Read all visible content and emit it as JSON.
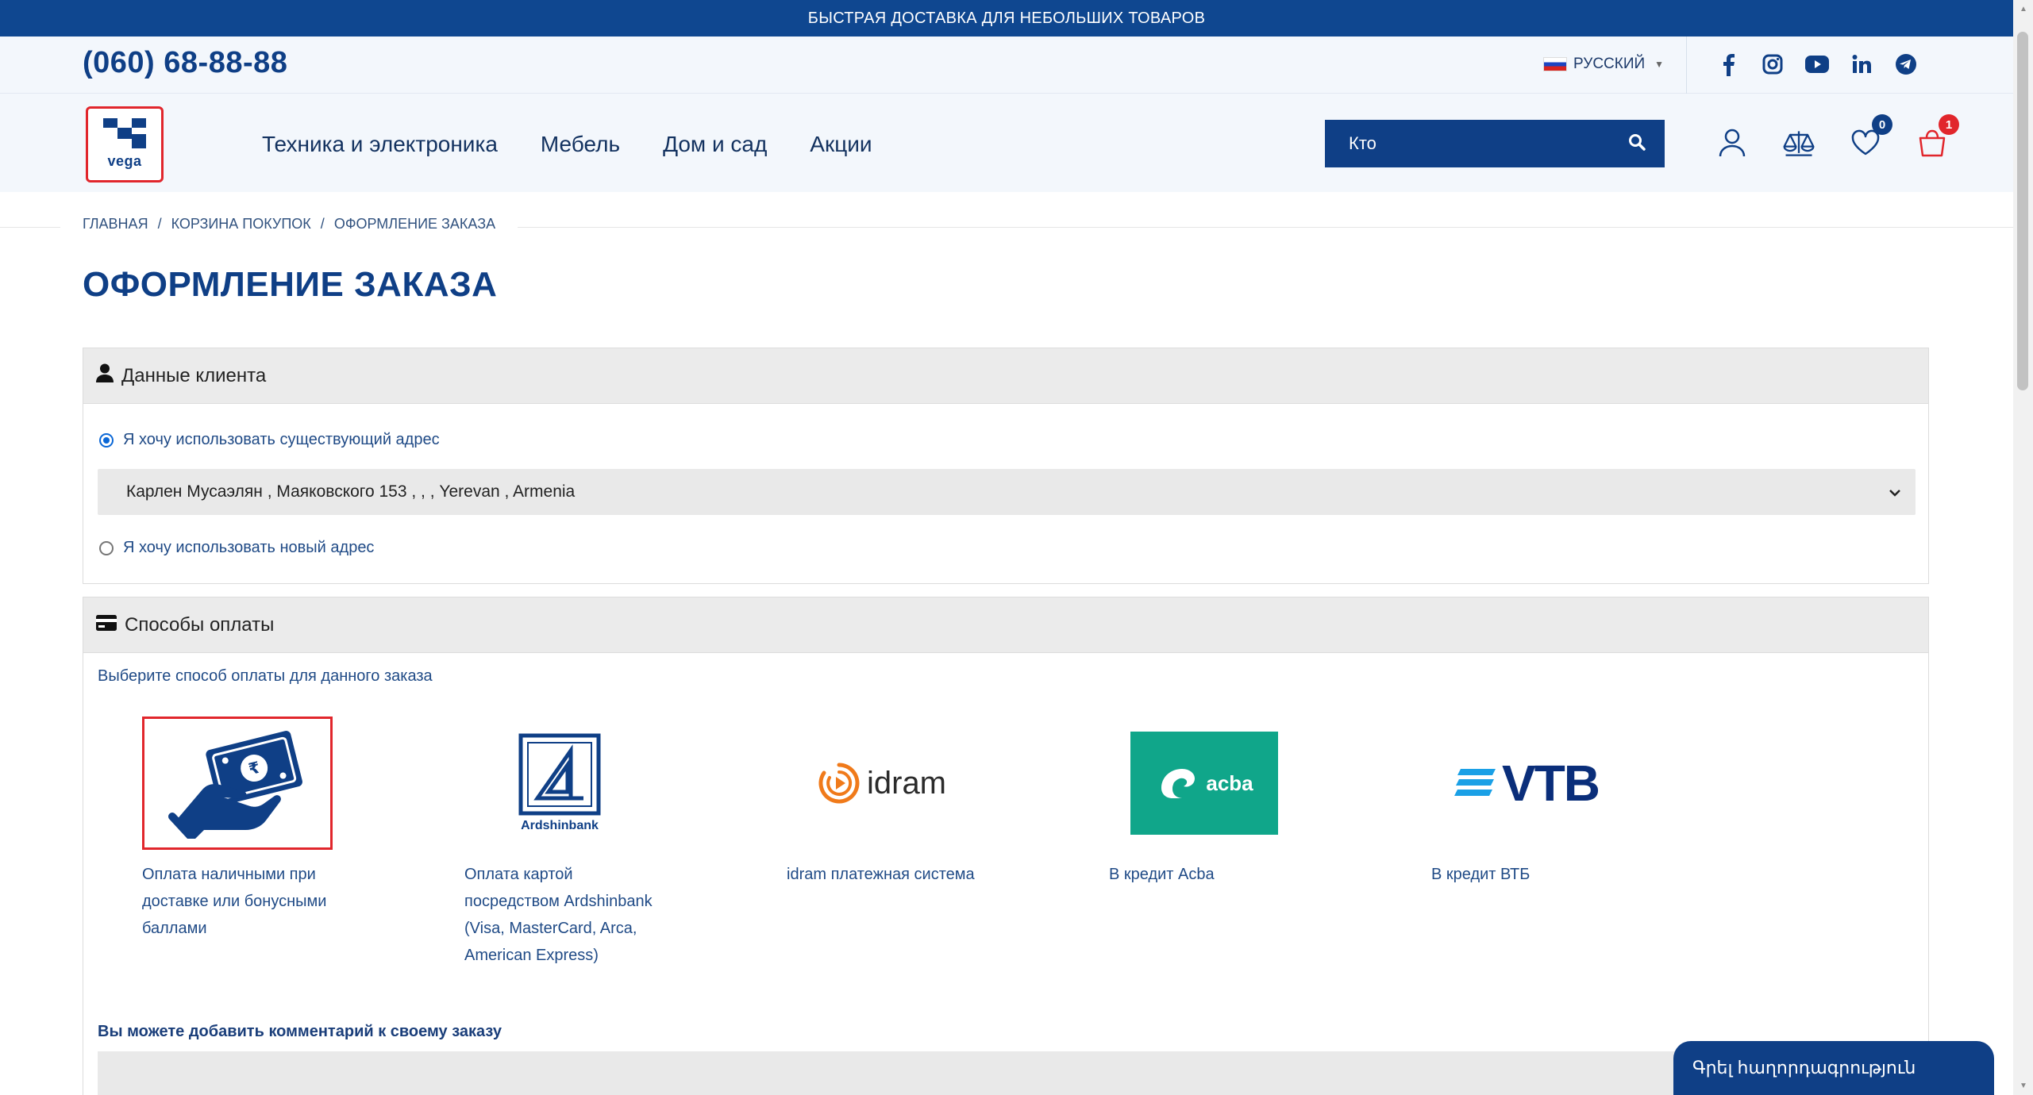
{
  "promo": {
    "text": "БЫСТРАЯ ДОСТАВКА ДЛЯ НЕБОЛЬШИХ ТОВАРОВ"
  },
  "topline": {
    "phone": "(060) 68-88-88",
    "language": "РУССКИЙ",
    "socials": [
      "facebook-icon",
      "instagram-icon",
      "youtube-icon",
      "linkedin-icon",
      "telegram-icon"
    ]
  },
  "header": {
    "logo_text": "vega",
    "nav": [
      "Техника и электроника",
      "Мебель",
      "Дом и сад",
      "Акции"
    ],
    "search_value": "Кто",
    "wishlist_count": "0",
    "cart_count": "1"
  },
  "breadcrumb": [
    "ГЛАВНАЯ",
    "КОРЗИНА ПОКУПОК",
    "ОФОРМЛЕНИЕ ЗАКАЗА"
  ],
  "page_title": "ОФОРМЛЕНИЕ ЗАКАЗА",
  "customer": {
    "heading": "Данные клиента",
    "existing_label": "Я хочу использовать существующий адрес",
    "address_selected": "Карлен Мусаэлян , Маяковского 153 , , , Yerevan , Armenia",
    "new_label": "Я хочу использовать новый адрес"
  },
  "payment": {
    "heading": "Способы оплаты",
    "hint": "Выберите способ оплаты для данного заказа",
    "methods": [
      {
        "label": "Оплата наличными при доставке или бонусными баллами",
        "logo_text": ""
      },
      {
        "label": "Оплата картой посредством Ardshinbank (Visa, MasterCard, Arca, American Express)",
        "logo_text": "Ardshinbank"
      },
      {
        "label": "idram платежная система",
        "logo_text": "idram"
      },
      {
        "label": "В кредит Acba",
        "logo_text": "acba"
      },
      {
        "label": "В кредит ВТБ",
        "logo_text": "VTB"
      }
    ],
    "comment_label": "Вы можете добавить комментарий к своему заказу"
  },
  "chat": {
    "label": "Գրել հաղորդագրություն"
  },
  "colors": {
    "brand": "#0f3f86",
    "accent": "#e1262c",
    "acba": "#10a68a",
    "idram": "#f07a1a"
  }
}
